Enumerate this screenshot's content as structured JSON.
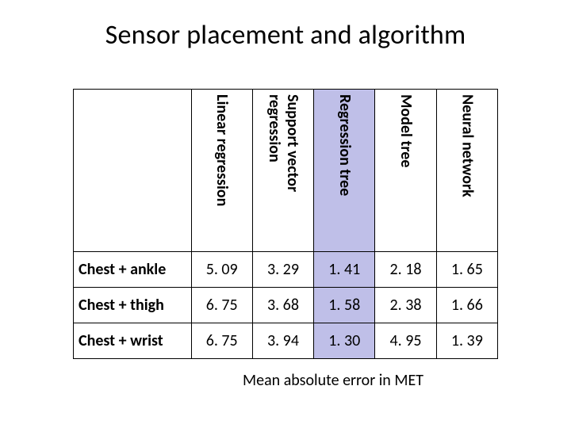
{
  "title": "Sensor placement and algorithm",
  "caption": "Mean absolute error in MET",
  "highlight_column_index": 2,
  "columns": [
    "Linear regression",
    "Support vector regression",
    "Regression tree",
    "Model tree",
    "Neural network"
  ],
  "rows": [
    {
      "label": "Chest + ankle",
      "values": [
        "5. 09",
        "3. 29",
        "1. 41",
        "2. 18",
        "1. 65"
      ]
    },
    {
      "label": "Chest + thigh",
      "values": [
        "6. 75",
        "3. 68",
        "1. 58",
        "2. 38",
        "1. 66"
      ]
    },
    {
      "label": "Chest + wrist",
      "values": [
        "6. 75",
        "3. 94",
        "1. 30",
        "4. 95",
        "1. 39"
      ]
    }
  ],
  "chart_data": {
    "type": "table",
    "title": "Sensor placement and algorithm",
    "ylabel": "Mean absolute error in MET",
    "columns": [
      "Linear regression",
      "Support vector regression",
      "Regression tree",
      "Model tree",
      "Neural network"
    ],
    "rows": [
      "Chest + ankle",
      "Chest + thigh",
      "Chest + wrist"
    ],
    "values": [
      [
        5.09,
        3.29,
        1.41,
        2.18,
        1.65
      ],
      [
        6.75,
        3.68,
        1.58,
        2.38,
        1.66
      ],
      [
        6.75,
        3.94,
        1.3,
        4.95,
        1.39
      ]
    ],
    "highlighted_column": "Regression tree"
  }
}
